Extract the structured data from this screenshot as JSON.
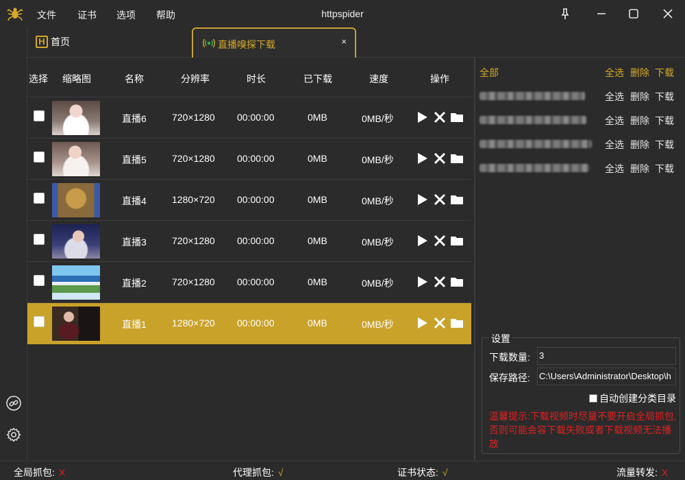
{
  "app": {
    "title": "httpspider"
  },
  "menu": [
    "文件",
    "证书",
    "选项",
    "帮助"
  ],
  "tabs": {
    "home": "首页",
    "active": "直播嗅探下载",
    "close": "×"
  },
  "table": {
    "headers": [
      "选择",
      "缩略图",
      "名称",
      "分辨率",
      "时长",
      "已下载",
      "速度",
      "操作"
    ],
    "rows": [
      {
        "name": "直播6",
        "resolution": "720×1280",
        "duration": "00:00:00",
        "downloaded": "0MB",
        "speed": "0MB/秒",
        "selected": false
      },
      {
        "name": "直播5",
        "resolution": "720×1280",
        "duration": "00:00:00",
        "downloaded": "0MB",
        "speed": "0MB/秒",
        "selected": false
      },
      {
        "name": "直播4",
        "resolution": "1280×720",
        "duration": "00:00:00",
        "downloaded": "0MB",
        "speed": "0MB/秒",
        "selected": false
      },
      {
        "name": "直播3",
        "resolution": "720×1280",
        "duration": "00:00:00",
        "downloaded": "0MB",
        "speed": "0MB/秒",
        "selected": false
      },
      {
        "name": "直播2",
        "resolution": "720×1280",
        "duration": "00:00:00",
        "downloaded": "0MB",
        "speed": "0MB/秒",
        "selected": false
      },
      {
        "name": "直播1",
        "resolution": "1280×720",
        "duration": "00:00:00",
        "downloaded": "0MB",
        "speed": "0MB/秒",
        "selected": true
      }
    ]
  },
  "groups": {
    "all_label": "全部",
    "actions": {
      "select_all": "全选",
      "delete": "删除",
      "download": "下载"
    }
  },
  "settings": {
    "title": "设置",
    "download_count_label": "下载数量:",
    "download_count": "3",
    "save_path_label": "保存路径:",
    "save_path": "C:\\Users\\Administrator\\Desktop\\h",
    "auto_create_label": "自动创建分类目录",
    "tip": "温馨提示:下载视频时尽量不要开启全局抓包,否则可能会容下载失败或者下载视频无法播放"
  },
  "status": {
    "global_capture": {
      "label": "全局抓包:",
      "value": "X"
    },
    "proxy_capture": {
      "label": "代理抓包:",
      "value": "√"
    },
    "cert_status": {
      "label": "证书状态:",
      "value": "√"
    },
    "traffic_forward": {
      "label": "流量转发:",
      "value": "X"
    }
  },
  "colors": {
    "accent": "#d4a82a",
    "selected_row": "#c9a22a",
    "background": "#2b2b2b",
    "warning": "#e02020"
  }
}
